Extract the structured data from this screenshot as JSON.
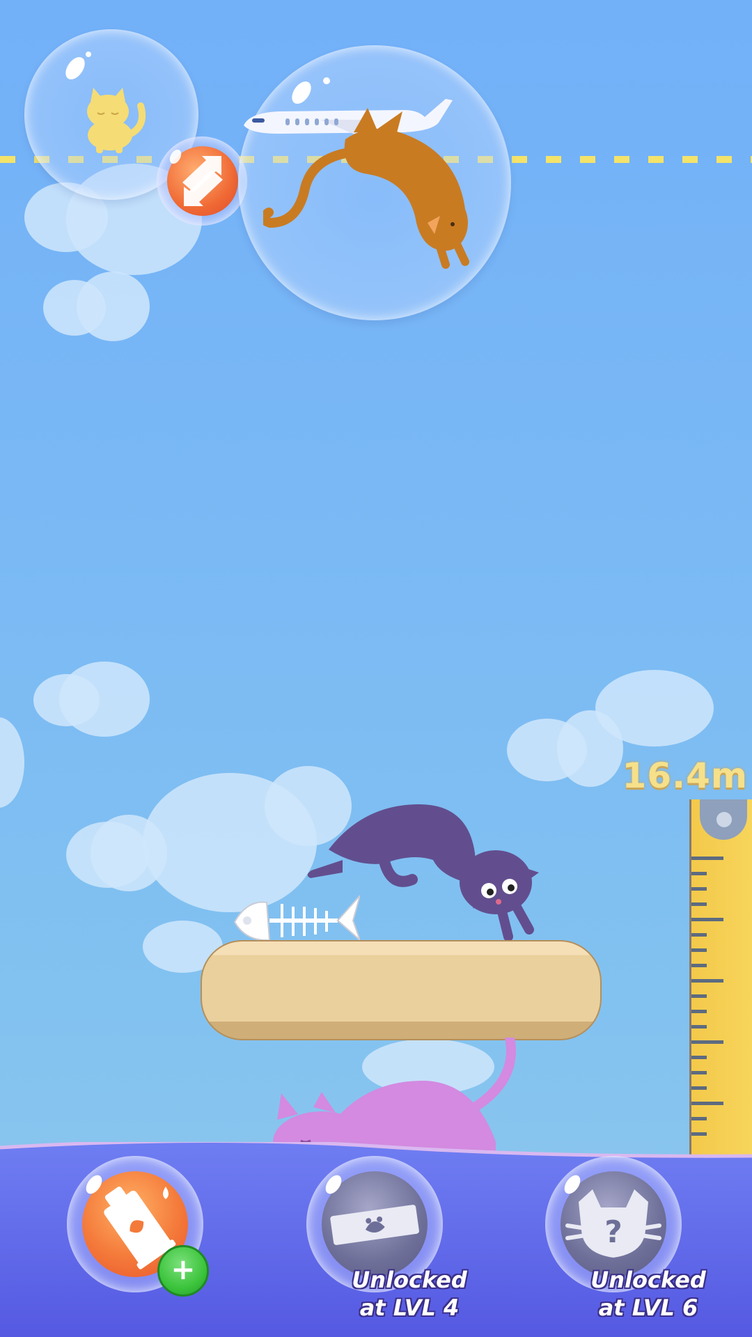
{
  "height_display": "16.4m",
  "powerups": [
    {
      "name": "glue-tube",
      "state": "available",
      "plus_label": "+"
    },
    {
      "name": "bandage",
      "state": "locked",
      "lock_line1": "Unlocked",
      "lock_line2": "at LVL 4"
    },
    {
      "name": "mystery-cat",
      "state": "locked",
      "lock_line1": "Unlocked",
      "lock_line2": "at LVL 6"
    }
  ],
  "colors": {
    "sky_top": "#72b0f8",
    "sea": "#6673ec",
    "ruler": "#f5cf52",
    "height_text": "#f6e08a",
    "accent_orange": "#f47a3a",
    "plus_green": "#3cc43c"
  },
  "icons": [
    "swap-icon",
    "glue-tube-icon",
    "bandage-icon",
    "mystery-cat-icon",
    "plus-icon"
  ]
}
